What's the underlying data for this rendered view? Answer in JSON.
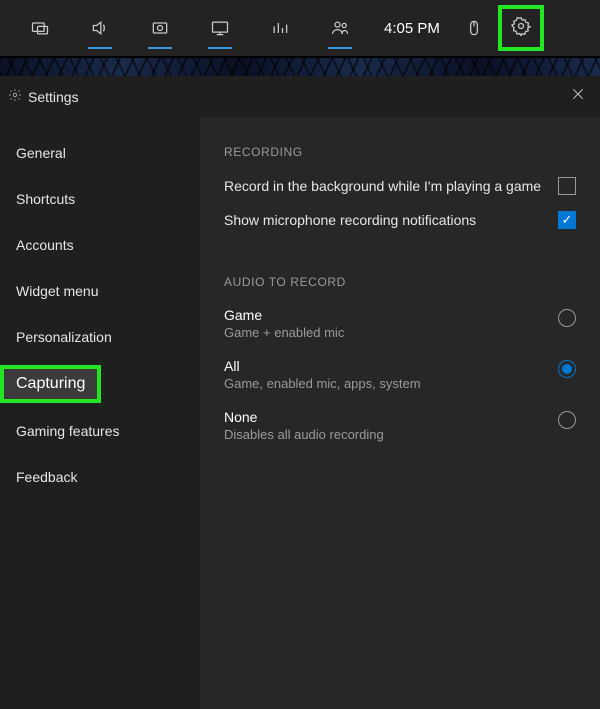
{
  "gamebar": {
    "time": "4:05 PM",
    "icons": {
      "widget": "widget-icon",
      "volume": "volume-icon",
      "capture": "capture-icon",
      "display": "display-icon",
      "perf": "performance-icon",
      "party": "party-icon",
      "mouse": "mouse-icon",
      "gear": "gear-icon"
    }
  },
  "settings": {
    "title": "Settings",
    "close_aria": "Close"
  },
  "sidebar": {
    "items": [
      "General",
      "Shortcuts",
      "Accounts",
      "Widget menu",
      "Personalization",
      "Capturing",
      "Gaming features",
      "Feedback"
    ],
    "selected_index": 5
  },
  "content": {
    "recording_head": "RECORDING",
    "bg_record_label": "Record in the background while I'm playing a game",
    "bg_record_checked": false,
    "mic_notif_label": "Show microphone recording notifications",
    "mic_notif_checked": true,
    "audio_head": "AUDIO TO RECORD",
    "options": [
      {
        "title": "Game",
        "sub": "Game + enabled mic",
        "selected": false
      },
      {
        "title": "All",
        "sub": "Game, enabled mic, apps, system",
        "selected": true
      },
      {
        "title": "None",
        "sub": "Disables all audio recording",
        "selected": false
      }
    ]
  },
  "highlights": {
    "color": "#22e622"
  }
}
